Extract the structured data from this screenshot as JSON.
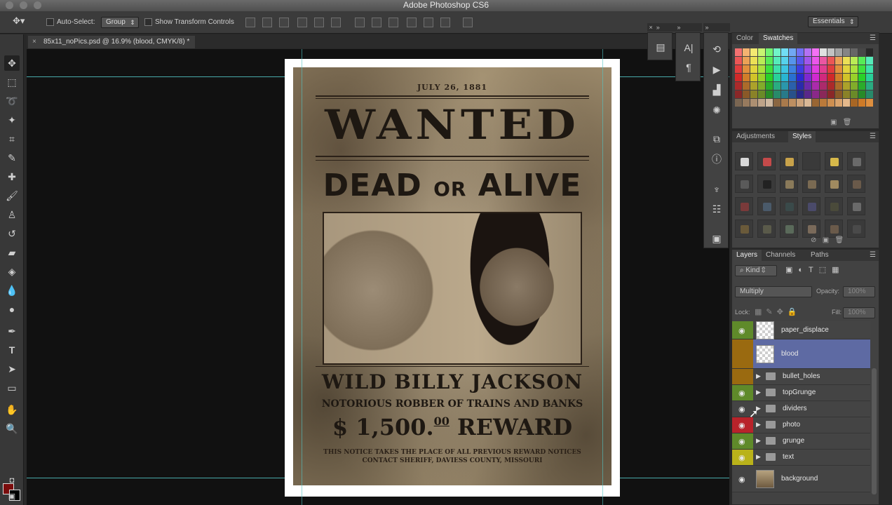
{
  "window": {
    "title": "Adobe Photoshop CS6"
  },
  "options": {
    "auto_select_label": "Auto-Select:",
    "auto_select_value": "Group",
    "show_transform_label": "Show Transform Controls",
    "workspace": "Essentials"
  },
  "document": {
    "tab_title": "85x11_noPics.psd @ 16.9% (blood, CMYK/8) *"
  },
  "poster": {
    "date": "JULY 26, 1881",
    "wanted": "WANTED",
    "dead": "DEAD",
    "or": "OR",
    "alive": "ALIVE",
    "name": "WILD BILLY JACKSON",
    "subtitle": "NOTORIOUS ROBBER OF TRAINS AND BANKS",
    "reward_prefix": "$ 1,500.",
    "reward_cents": "00",
    "reward_suffix": " REWARD",
    "fine1": "THIS NOTICE TAKES THE PLACE OF ALL PREVIOUS REWARD NOTICES",
    "fine2": "CONTACT SHERIFF, DAVIESS COUNTY, MISSOURI"
  },
  "panels": {
    "color_tab": "Color",
    "swatches_tab": "Swatches",
    "adjustments_tab": "Adjustments",
    "styles_tab": "Styles",
    "layers_tab": "Layers",
    "channels_tab": "Channels",
    "paths_tab": "Paths"
  },
  "layers_panel": {
    "kind_filter": "Kind",
    "blend_mode": "Multiply",
    "opacity_label": "Opacity:",
    "opacity_value": "100%",
    "lock_label": "Lock:",
    "fill_label": "Fill:",
    "fill_value": "100%",
    "layers": [
      {
        "name": "paper_displace",
        "type": "layer",
        "visible": true,
        "label_color": "#5f8a2a"
      },
      {
        "name": "blood",
        "type": "layer",
        "visible": false,
        "label_color": "#9a6a10",
        "selected": true
      },
      {
        "name": "bullet_holes",
        "type": "group",
        "visible": false,
        "label_color": "#9a6a10"
      },
      {
        "name": "topGrunge",
        "type": "group",
        "visible": true,
        "label_color": "#5f8a2a"
      },
      {
        "name": "dividers",
        "type": "group",
        "visible": true,
        "label_color": "#444444"
      },
      {
        "name": "photo",
        "type": "group",
        "visible": true,
        "label_color": "#b8232a"
      },
      {
        "name": "grunge",
        "type": "group",
        "visible": true,
        "label_color": "#5f8a2a"
      },
      {
        "name": "text",
        "type": "group",
        "visible": true,
        "label_color": "#b9b21a"
      },
      {
        "name": "background",
        "type": "layer",
        "visible": true,
        "label_color": "#444444"
      }
    ]
  },
  "colors": {
    "foreground": "#7a0c0c",
    "background": "#000000",
    "guide": "#53c6c6",
    "selection": "#5e6aa3"
  }
}
